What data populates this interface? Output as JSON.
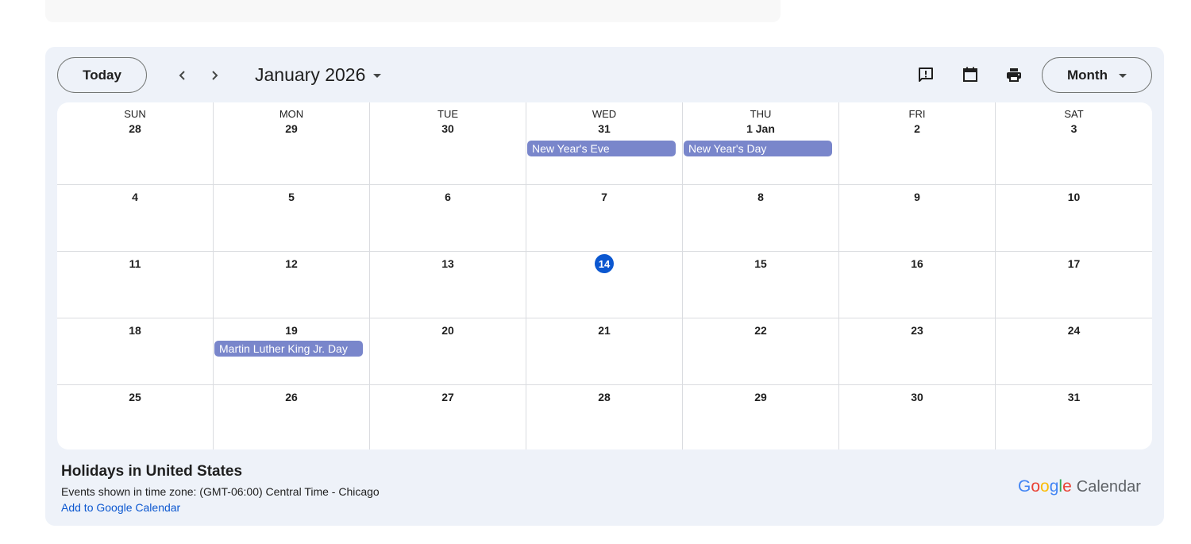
{
  "toolbar": {
    "today_label": "Today",
    "prev_icon": "chevron-left-icon",
    "next_icon": "chevron-right-icon",
    "month_title": "January 2026",
    "view_label": "Month",
    "icons": [
      "feedback-icon",
      "calendar-icon",
      "print-icon"
    ]
  },
  "calendar": {
    "weekdays": [
      "SUN",
      "MON",
      "TUE",
      "WED",
      "THU",
      "FRI",
      "SAT"
    ],
    "weeks": [
      [
        {
          "day": "28",
          "events": []
        },
        {
          "day": "29",
          "events": []
        },
        {
          "day": "30",
          "events": []
        },
        {
          "day": "31",
          "events": [
            "New Year's Eve"
          ]
        },
        {
          "day": "1 Jan",
          "events": [
            "New Year's Day"
          ]
        },
        {
          "day": "2",
          "events": []
        },
        {
          "day": "3",
          "events": []
        }
      ],
      [
        {
          "day": "4",
          "events": []
        },
        {
          "day": "5",
          "events": []
        },
        {
          "day": "6",
          "events": []
        },
        {
          "day": "7",
          "events": []
        },
        {
          "day": "8",
          "events": []
        },
        {
          "day": "9",
          "events": []
        },
        {
          "day": "10",
          "events": []
        }
      ],
      [
        {
          "day": "11",
          "events": []
        },
        {
          "day": "12",
          "events": []
        },
        {
          "day": "13",
          "events": []
        },
        {
          "day": "14",
          "events": [],
          "today": true
        },
        {
          "day": "15",
          "events": []
        },
        {
          "day": "16",
          "events": []
        },
        {
          "day": "17",
          "events": []
        }
      ],
      [
        {
          "day": "18",
          "events": []
        },
        {
          "day": "19",
          "events": [
            "Martin Luther King Jr. Day"
          ]
        },
        {
          "day": "20",
          "events": []
        },
        {
          "day": "21",
          "events": []
        },
        {
          "day": "22",
          "events": []
        },
        {
          "day": "23",
          "events": []
        },
        {
          "day": "24",
          "events": []
        }
      ],
      [
        {
          "day": "25",
          "events": []
        },
        {
          "day": "26",
          "events": []
        },
        {
          "day": "27",
          "events": []
        },
        {
          "day": "28",
          "events": []
        },
        {
          "day": "29",
          "events": []
        },
        {
          "day": "30",
          "events": []
        },
        {
          "day": "31",
          "events": []
        }
      ]
    ],
    "event_color": "#7986cb",
    "today_color": "#0b57d0"
  },
  "footer": {
    "title": "Holidays in United States",
    "timezone_text": "Events shown in time zone: (GMT-06:00) Central Time - Chicago",
    "add_link": "Add to Google Calendar",
    "logo_google": "Google",
    "logo_calendar": "Calendar"
  }
}
